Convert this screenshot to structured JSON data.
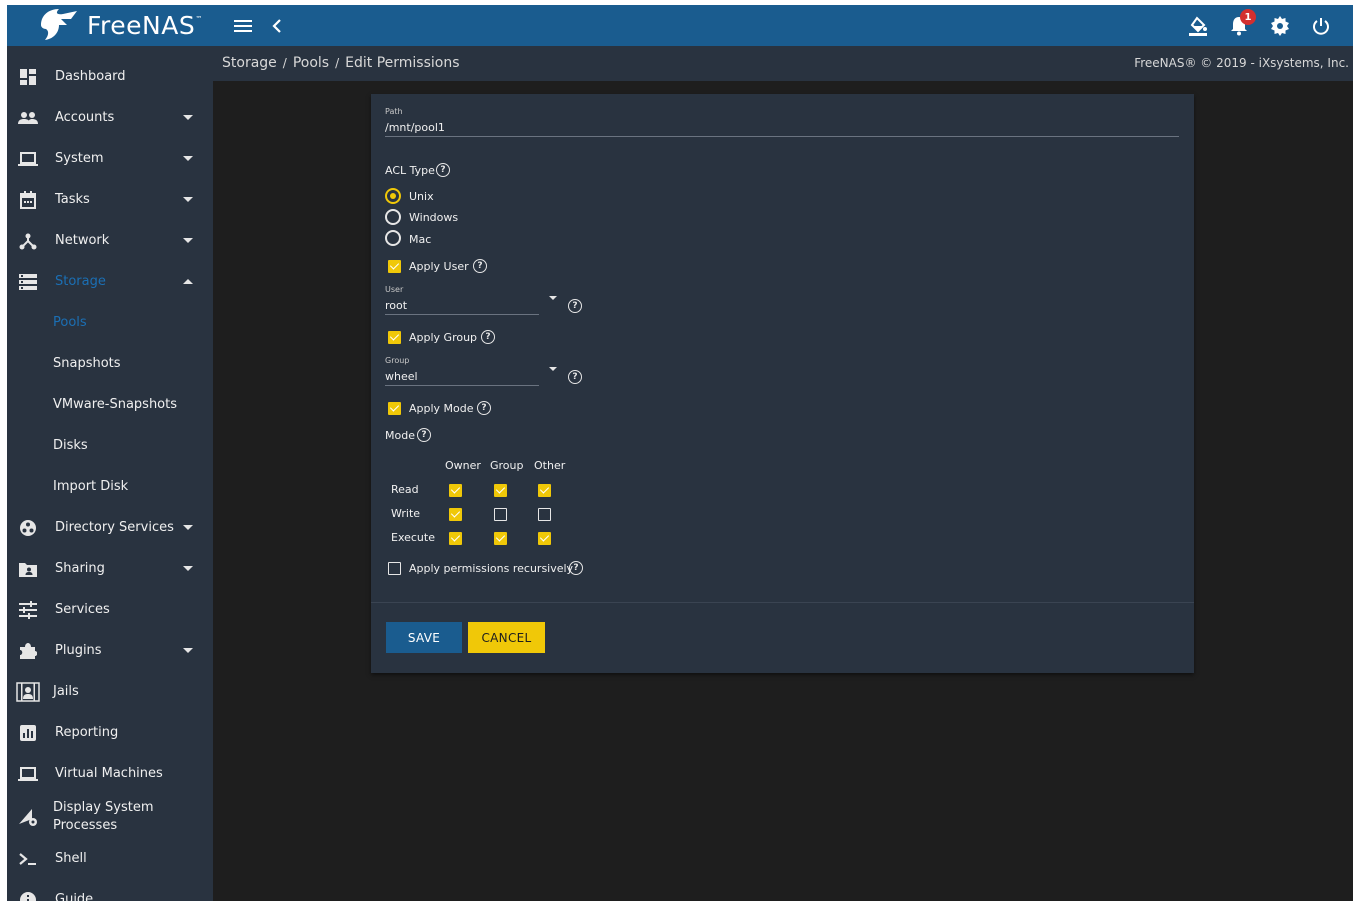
{
  "brand": {
    "name": "FreeNAS",
    "trademark": "™"
  },
  "topbar": {
    "notifications_count": "1"
  },
  "sidebar": {
    "items": [
      {
        "label": "Dashboard"
      },
      {
        "label": "Accounts"
      },
      {
        "label": "System"
      },
      {
        "label": "Tasks"
      },
      {
        "label": "Network"
      },
      {
        "label": "Storage"
      },
      {
        "label": "Directory Services"
      },
      {
        "label": "Sharing"
      },
      {
        "label": "Services"
      },
      {
        "label": "Plugins"
      },
      {
        "label": "Jails"
      },
      {
        "label": "Reporting"
      },
      {
        "label": "Virtual Machines"
      },
      {
        "label": "Display System Processes"
      },
      {
        "label": "Shell"
      },
      {
        "label": "Guide"
      }
    ],
    "storage_children": [
      {
        "label": "Pools"
      },
      {
        "label": "Snapshots"
      },
      {
        "label": "VMware-Snapshots"
      },
      {
        "label": "Disks"
      },
      {
        "label": "Import Disk"
      }
    ]
  },
  "breadcrumb": [
    "Storage",
    "Pools",
    "Edit Permissions"
  ],
  "copyright": "FreeNAS® © 2019 - iXsystems, Inc.",
  "form": {
    "path_label": "Path",
    "path_value": "/mnt/pool1",
    "acl_type_label": "ACL Type",
    "acl_options": [
      {
        "label": "Unix",
        "selected": true
      },
      {
        "label": "Windows",
        "selected": false
      },
      {
        "label": "Mac",
        "selected": false
      }
    ],
    "apply_user_label": "Apply User",
    "user_label": "User",
    "user_value": "root",
    "apply_group_label": "Apply Group",
    "group_label": "Group",
    "group_value": "wheel",
    "apply_mode_label": "Apply Mode",
    "mode_label": "Mode",
    "mode_columns": [
      "Owner",
      "Group",
      "Other"
    ],
    "mode_rows": [
      {
        "label": "Read",
        "values": [
          true,
          true,
          true
        ]
      },
      {
        "label": "Write",
        "values": [
          true,
          false,
          false
        ]
      },
      {
        "label": "Execute",
        "values": [
          true,
          true,
          true
        ]
      }
    ],
    "recursive_label": "Apply permissions recursively",
    "save_label": "SAVE",
    "cancel_label": "CANCEL"
  },
  "colors": {
    "accent": "#1a5c8f",
    "yellow": "#f0c808",
    "panel": "#293340",
    "background": "#1e1e1e"
  }
}
